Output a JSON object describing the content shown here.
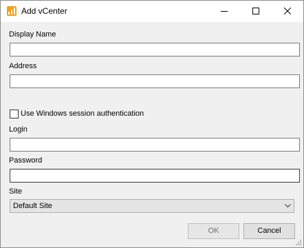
{
  "window": {
    "title": "Add vCenter",
    "app_icon": "chart-bars-icon",
    "controls": [
      "minimize-icon",
      "maximize-icon",
      "close-icon"
    ]
  },
  "form": {
    "display_name": {
      "label": "Display Name",
      "value": "",
      "placeholder": ""
    },
    "address": {
      "label": "Address",
      "value": "",
      "placeholder": ""
    },
    "windows_auth": {
      "label": "Use Windows session authentication",
      "checked": false
    },
    "login": {
      "label": "Login",
      "value": "",
      "placeholder": ""
    },
    "password": {
      "label": "Password",
      "value": "",
      "placeholder": ""
    },
    "site": {
      "label": "Site",
      "selected": "Default Site"
    }
  },
  "buttons": {
    "ok_label": "OK",
    "cancel_label": "Cancel"
  },
  "colors": {
    "accent": "#f0a01e",
    "background": "#f0f0f0",
    "titlebar": "#ffffff"
  }
}
